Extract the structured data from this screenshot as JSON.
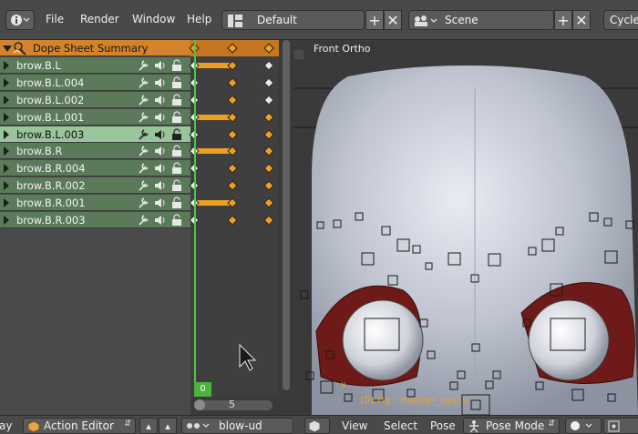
{
  "topbar": {
    "menus": [
      "File",
      "Render",
      "Window",
      "Help"
    ],
    "screen_layout": "Default",
    "scene": "Scene",
    "engine_partial": "Cycle"
  },
  "channels": {
    "summary_label": "Dope Sheet Summary",
    "items": [
      {
        "label": "brow.B.L",
        "selected": false
      },
      {
        "label": "brow.B.L.004",
        "selected": false
      },
      {
        "label": "brow.B.L.002",
        "selected": false
      },
      {
        "label": "brow.B.L.001",
        "selected": false
      },
      {
        "label": "brow.B.L.003",
        "selected": true
      },
      {
        "label": "brow.B.R",
        "selected": false
      },
      {
        "label": "brow.B.R.004",
        "selected": false
      },
      {
        "label": "brow.B.R.002",
        "selected": false
      },
      {
        "label": "brow.B.R.001",
        "selected": false
      },
      {
        "label": "brow.B.R.003",
        "selected": false
      }
    ]
  },
  "timeline": {
    "current_frame": "0",
    "scroll_frame_label": "5"
  },
  "viewport": {
    "view_label": "Front Ortho",
    "status_text": "(0) rig : master_eye.L",
    "axis_hint": "x"
  },
  "bottombar": {
    "left_partial": "ay",
    "editor_mode": "Action Editor",
    "action_name": "blow-ud",
    "view_menu": "View",
    "select_menu": "Select",
    "pose_menu": "Pose",
    "interaction_mode": "Pose Mode"
  },
  "colors": {
    "summary_row": "#d5832a",
    "channel_row": "#5a7a5a",
    "channel_selected": "#9ac59a",
    "keyframe": "#f0a020",
    "playhead": "#4cc846"
  }
}
